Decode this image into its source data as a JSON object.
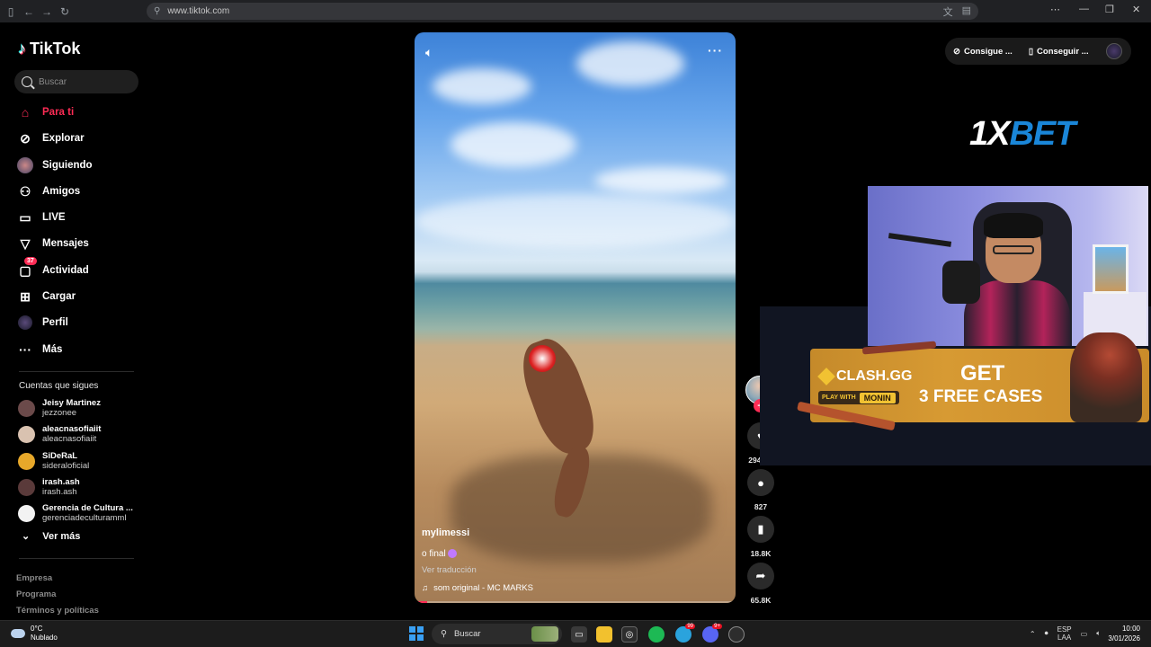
{
  "browser": {
    "url": "www.tiktok.com"
  },
  "sidebar": {
    "logo_text": "TikTok",
    "search_placeholder": "Buscar",
    "nav": [
      {
        "label": "Para ti",
        "icon": "home-icon"
      },
      {
        "label": "Explorar",
        "icon": "compass-icon"
      },
      {
        "label": "Siguiendo",
        "icon": "following-avatar-icon"
      },
      {
        "label": "Amigos",
        "icon": "friends-icon"
      },
      {
        "label": "LIVE",
        "icon": "live-tv-icon"
      },
      {
        "label": "Mensajes",
        "icon": "send-icon"
      },
      {
        "label": "Actividad",
        "icon": "inbox-icon",
        "badge": "37"
      },
      {
        "label": "Cargar",
        "icon": "upload-icon"
      },
      {
        "label": "Perfil",
        "icon": "profile-avatar-icon"
      },
      {
        "label": "Más",
        "icon": "more-icon"
      }
    ],
    "following_title": "Cuentas que sigues",
    "accounts": [
      {
        "name": "Jeisy Martinez",
        "handle": "jezzonee",
        "color": "#6b4a4a"
      },
      {
        "name": "aleacnasofiaiit",
        "handle": "aleacnasofiaiit",
        "color": "#d9c2b0"
      },
      {
        "name": "SiDeRaL",
        "handle": "sideraloficial",
        "color": "#e7a82a"
      },
      {
        "name": "irash.ash",
        "handle": "irash.ash",
        "color": "#5a3a3a"
      },
      {
        "name": "Gerencia de Cultura ...",
        "handle": "gerenciadeculturamml",
        "color": "#f2f2f2"
      }
    ],
    "see_more": "Ver más",
    "footer": [
      "Empresa",
      "Programa",
      "Términos y políticas"
    ]
  },
  "video": {
    "author": "mylimessi",
    "caption": "o final",
    "translate": "Ver traducción",
    "music": "som original - MC MARKS",
    "progress": 0.04
  },
  "actions": {
    "likes": "294.1K",
    "comments": "827",
    "saves": "18.8K",
    "shares": "65.8K"
  },
  "topright": {
    "btn1": "Consigue ...",
    "btn2": "Conseguir ..."
  },
  "overlay": {
    "sponsor": "1XBET",
    "clash_logo": "CLASH.GG",
    "play_with": "PLAY WITH",
    "monin": "MONIN",
    "get": "GET",
    "free_cases": "3 FREE CASES"
  },
  "taskbar": {
    "temp": "0°C",
    "weather": "Nublado",
    "search": "Buscar",
    "lang1": "ESP",
    "lang2": "LAA",
    "time": "10:00",
    "date": "3/01/2026",
    "badge_telegram": "99",
    "badge_discord": "9+"
  },
  "colors": {
    "accent": "#fe2c55",
    "background": "#000000"
  }
}
